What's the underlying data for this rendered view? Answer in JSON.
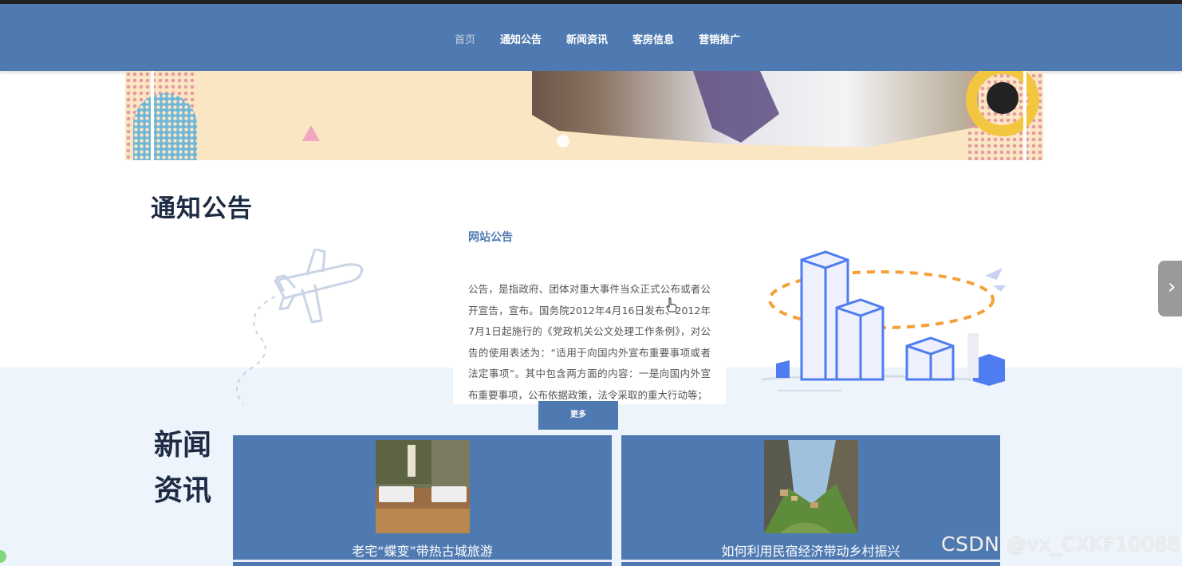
{
  "nav": {
    "items": [
      {
        "label": "首页",
        "active": true
      },
      {
        "label": "通知公告",
        "active": false
      },
      {
        "label": "新闻资讯",
        "active": false
      },
      {
        "label": "客房信息",
        "active": false
      },
      {
        "label": "营销推广",
        "active": false
      }
    ]
  },
  "notice_section": {
    "heading": "通知公告",
    "card": {
      "title": "网站公告",
      "body": "公告，是指政府、团体对重大事件当众正式公布或者公开宣告，宣布。国务院2012年4月16日发布、2012年7月1日起施行的《党政机关公文处理工作条例》，对公告的使用表述为：“适用于向国内外宣布重要事项或者法定事项”。其中包含两方面的内容：一是向国内外宣布重要事项，公布依据政策，法令采取的重大行动等；"
    },
    "more_label": "更多"
  },
  "news_section": {
    "heading": "新闻资讯",
    "items": [
      {
        "title": "老宅“蝶变”带热古城旅游"
      },
      {
        "title": "如何利用民宿经济带动乡村振兴"
      }
    ]
  },
  "watermark": "CSDN @vx_CXKF10088",
  "colors": {
    "primary": "#4f7ab1",
    "heading": "#1d2b45",
    "band": "#eef4fb"
  }
}
